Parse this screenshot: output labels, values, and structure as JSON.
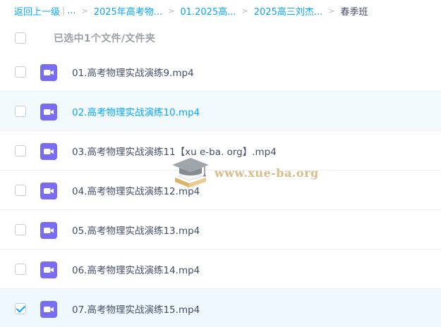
{
  "breadcrumb": {
    "back": "返回上一级",
    "sep": "|",
    "ellipsis": "...",
    "chevron": ">",
    "crumbs": [
      "2025年高考物...",
      "01.2025高...",
      "2025高三刘杰..."
    ],
    "current": "春季班"
  },
  "header": {
    "selection_text": "已选中1个文件/文件夹"
  },
  "files": [
    {
      "name": "01.高考物理实战演练9.mp4",
      "checked": false
    },
    {
      "name": "02.高考物理实战演练10.mp4",
      "checked": false,
      "hover": true
    },
    {
      "name": "03.高考物理实战演练11【xu e-ba. org】.mp4",
      "checked": false
    },
    {
      "name": "04.高考物理实战演练12.mp4",
      "checked": false
    },
    {
      "name": "05.高考物理实战演练13.mp4",
      "checked": false
    },
    {
      "name": "06.高考物理实战演练14.mp4",
      "checked": false
    },
    {
      "name": "07.高考物理实战演练15.mp4",
      "checked": true
    }
  ],
  "watermark": {
    "text": "www.xue-ba.org"
  },
  "colors": {
    "accent": "#06a7ff",
    "video_icon": "#7a6cf0",
    "text": "#424e67",
    "muted": "#9aa0a6"
  },
  "icons": {
    "file": "video-file-icon",
    "watermark": "graduation-cap-icon"
  }
}
